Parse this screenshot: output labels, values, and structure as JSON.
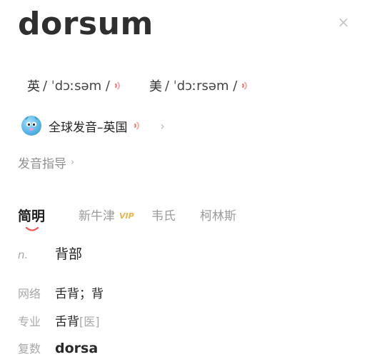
{
  "word": "dorsum",
  "close_label": "×",
  "pronunciation": {
    "uk": {
      "region": "英",
      "ipa": "/ ˈdɔːsəm /"
    },
    "us": {
      "region": "美",
      "ipa": "/ ˈdɔːrsəm /"
    }
  },
  "global_pronunciation": {
    "label": "全球发音–英国",
    "chevron": "›"
  },
  "guide": {
    "label": "发音指导",
    "chevron": "›"
  },
  "tabs": [
    {
      "label": "简明",
      "active": true
    },
    {
      "label": "新牛津",
      "badge": "VIP"
    },
    {
      "label": "韦氏"
    },
    {
      "label": "柯林斯"
    }
  ],
  "definitions": {
    "basic": {
      "pos": "n.",
      "text": "背部"
    },
    "web": {
      "label": "网络",
      "text": "舌背；背"
    },
    "specialty": {
      "label": "专业",
      "text": "舌背",
      "tag": "[医]"
    },
    "plural": {
      "label": "复数",
      "text": "dorsa"
    }
  },
  "colors": {
    "accent_red": "#f05a5a",
    "vip_gold": "#e8b64c",
    "muted_text": "#a8a8a8"
  },
  "icons": {
    "speaker": "speaker-icon",
    "close": "close-icon",
    "avatar": "globe-avatar-icon"
  }
}
